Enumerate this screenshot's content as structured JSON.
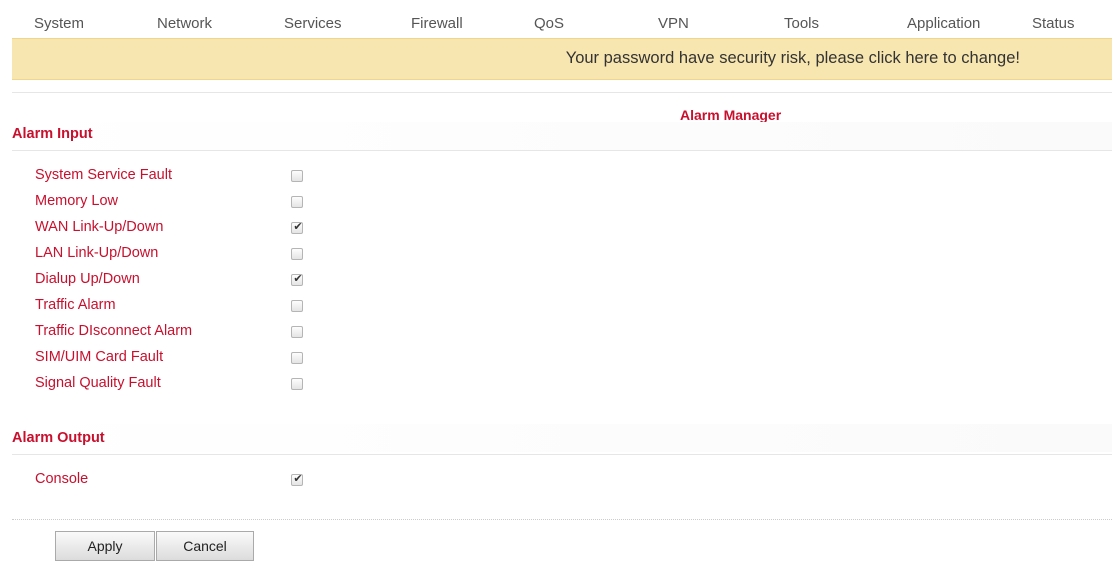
{
  "nav": {
    "items": [
      {
        "label": "System"
      },
      {
        "label": "Network"
      },
      {
        "label": "Services"
      },
      {
        "label": "Firewall"
      },
      {
        "label": "QoS"
      },
      {
        "label": "VPN"
      },
      {
        "label": "Tools"
      },
      {
        "label": "Application"
      },
      {
        "label": "Status"
      }
    ]
  },
  "banner": {
    "text": "Your password have security risk, please click here to change!",
    "color": "#f8e6b0"
  },
  "page": {
    "title": "Alarm Manager",
    "accent_color": "#c8102e"
  },
  "alarm_input": {
    "title": "Alarm Input",
    "items": [
      {
        "label": "System Service Fault",
        "checked": false
      },
      {
        "label": "Memory Low",
        "checked": false
      },
      {
        "label": "WAN Link-Up/Down",
        "checked": true
      },
      {
        "label": "LAN Link-Up/Down",
        "checked": false
      },
      {
        "label": "Dialup Up/Down",
        "checked": true
      },
      {
        "label": "Traffic Alarm",
        "checked": false
      },
      {
        "label": "Traffic DIsconnect Alarm",
        "checked": false
      },
      {
        "label": "SIM/UIM Card Fault",
        "checked": false
      },
      {
        "label": "Signal Quality Fault",
        "checked": false
      }
    ]
  },
  "alarm_output": {
    "title": "Alarm Output",
    "items": [
      {
        "label": "Console",
        "checked": true
      }
    ]
  },
  "actions": {
    "apply_label": "Apply",
    "cancel_label": "Cancel"
  }
}
